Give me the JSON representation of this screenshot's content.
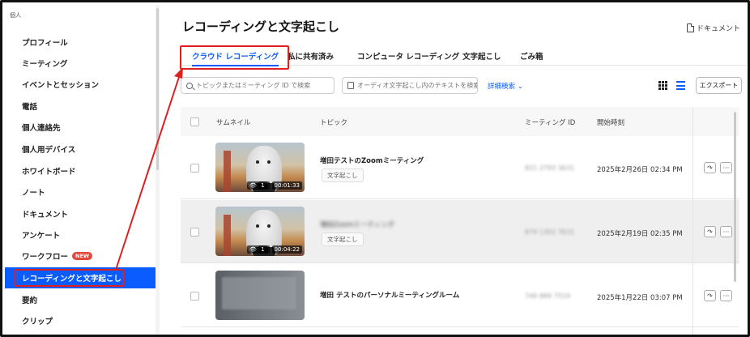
{
  "sidebar": {
    "section_label": "個人",
    "items": [
      {
        "label": "プロフィール"
      },
      {
        "label": "ミーティング"
      },
      {
        "label": "イベントとセッション"
      },
      {
        "label": "電話"
      },
      {
        "label": "個人連絡先"
      },
      {
        "label": "個人用デバイス"
      },
      {
        "label": "ホワイトボード"
      },
      {
        "label": "ノート"
      },
      {
        "label": "ドキュメント"
      },
      {
        "label": "アンケート"
      },
      {
        "label": "ワークフロー",
        "badge": "NEW"
      },
      {
        "label": "レコーディングと文字起こし",
        "active": true
      },
      {
        "label": "要約"
      },
      {
        "label": "クリップ"
      }
    ]
  },
  "header": {
    "title": "レコーディングと文字起こし",
    "doc_link": "ドキュメント"
  },
  "tabs": [
    {
      "label": "クラウド レコーディング",
      "active": true
    },
    {
      "label": "私に共有済み"
    },
    {
      "label": "コンピュータ レコーディング"
    },
    {
      "label": "文字起こし"
    },
    {
      "label": "ごみ箱"
    }
  ],
  "toolbar": {
    "search_placeholder": "トピックまたはミーティング ID で検索",
    "transcript_search_placeholder": "オーディオ文字起こし内のテキストを検索",
    "advanced_search": "詳細検索 ⌄",
    "export": "エクスポート"
  },
  "table": {
    "columns": [
      "サムネイル",
      "トピック",
      "ミーティング ID",
      "開始時刻"
    ],
    "rows": [
      {
        "topic": "増田テストのZoomミーティング",
        "tag": "文字起こし",
        "meeting_id": "821 2793 3631",
        "start": "2025年2月26日 02:34 PM",
        "views": "1",
        "duration": "00:01:33",
        "thumb": "bridge"
      },
      {
        "topic": "増田Zoomミーティング",
        "tag": "文字起こし",
        "meeting_id": "879 1302 7631",
        "start": "2025年2月19日 02:35 PM",
        "views": "1",
        "duration": "00:04:22",
        "thumb": "bridge",
        "hover": true
      },
      {
        "topic": "増田 テストのパーソナルミーティングルーム",
        "tag": "",
        "meeting_id": "749 889 7519",
        "start": "2025年1月22日 03:07 PM",
        "views": "",
        "duration": "",
        "thumb": "screen"
      }
    ]
  },
  "colors": {
    "accent": "#0b5cff",
    "highlight_red": "#e02020",
    "new_badge": "#e8453c"
  },
  "icons": {
    "doc": "document-icon",
    "search": "search-icon",
    "transcript": "transcript-icon",
    "grid_view": "grid-view-icon",
    "list_view": "list-view-icon",
    "share": "share-icon",
    "more": "more-icon",
    "views": "eye-icon"
  }
}
